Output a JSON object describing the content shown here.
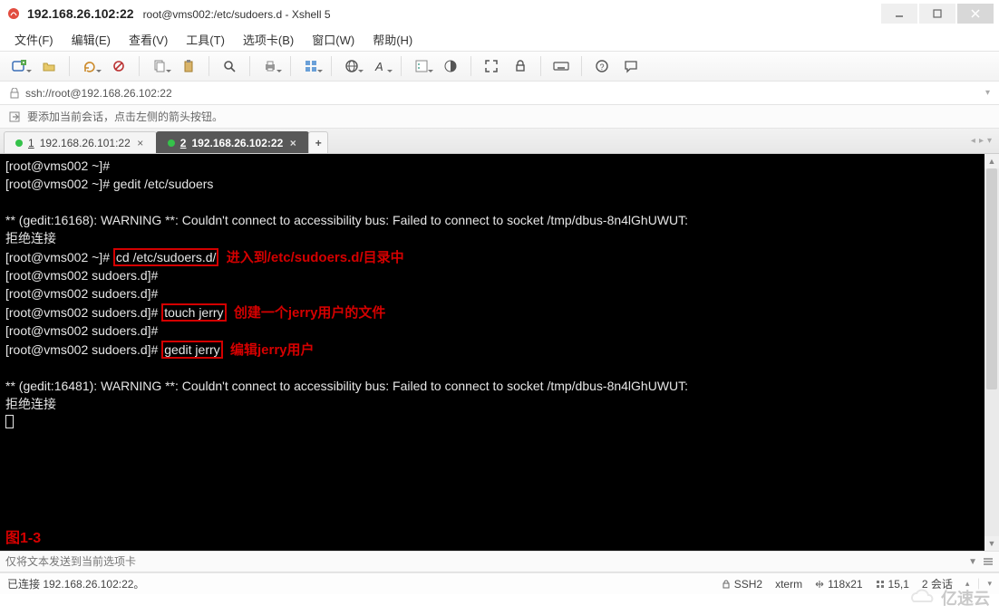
{
  "window": {
    "host_title": "192.168.26.102:22",
    "path_title": "root@vms002:/etc/sudoers.d - Xshell 5"
  },
  "menus": {
    "file": "文件(F)",
    "edit": "编辑(E)",
    "view": "查看(V)",
    "tools": "工具(T)",
    "tabs": "选项卡(B)",
    "window": "窗口(W)",
    "help": "帮助(H)"
  },
  "address_bar": {
    "url": "ssh://root@192.168.26.102:22"
  },
  "info_bar": {
    "tip": "要添加当前会话，点击左侧的箭头按钮。"
  },
  "tabs": [
    {
      "index": "1",
      "label": "192.168.26.101:22",
      "active": false
    },
    {
      "index": "2",
      "label": "192.168.26.102:22",
      "active": true
    }
  ],
  "terminal": {
    "l1": "[root@vms002 ~]#",
    "l2p": "[root@vms002 ~]# ",
    "l2c": "gedit /etc/sudoers",
    "l3": "",
    "l4": "** (gedit:16168): WARNING **: Couldn't connect to accessibility bus: Failed to connect to socket /tmp/dbus-8n4lGhUWUT: ",
    "l5": "拒绝连接",
    "l6p": "[root@vms002 ~]# ",
    "l6c": "cd /etc/sudoers.d/",
    "l6a": "  进入到/etc/sudoers.d/目录中",
    "l7": "[root@vms002 sudoers.d]#",
    "l8": "[root@vms002 sudoers.d]#",
    "l9p": "[root@vms002 sudoers.d]# ",
    "l9c": "touch jerry",
    "l9a": "  创建一个jerry用户的文件",
    "l10": "[root@vms002 sudoers.d]#",
    "l11p": "[root@vms002 sudoers.d]# ",
    "l11c": "gedit jerry",
    "l11a": "  编辑jerry用户",
    "l12": "",
    "l13": "** (gedit:16481): WARNING **: Couldn't connect to accessibility bus: Failed to connect to socket /tmp/dbus-8n4lGhUWUT: ",
    "l14": "拒绝连接",
    "figure_label": "图1-3"
  },
  "send_bar": {
    "placeholder": "仅将文本发送到当前选项卡"
  },
  "status_bar": {
    "conn": "已连接 192.168.26.102:22。",
    "proto": "SSH2",
    "term": "xterm",
    "size": "118x21",
    "pos": "15,1",
    "sessions_label": "2 会话"
  },
  "watermark": {
    "text": "亿速云"
  }
}
